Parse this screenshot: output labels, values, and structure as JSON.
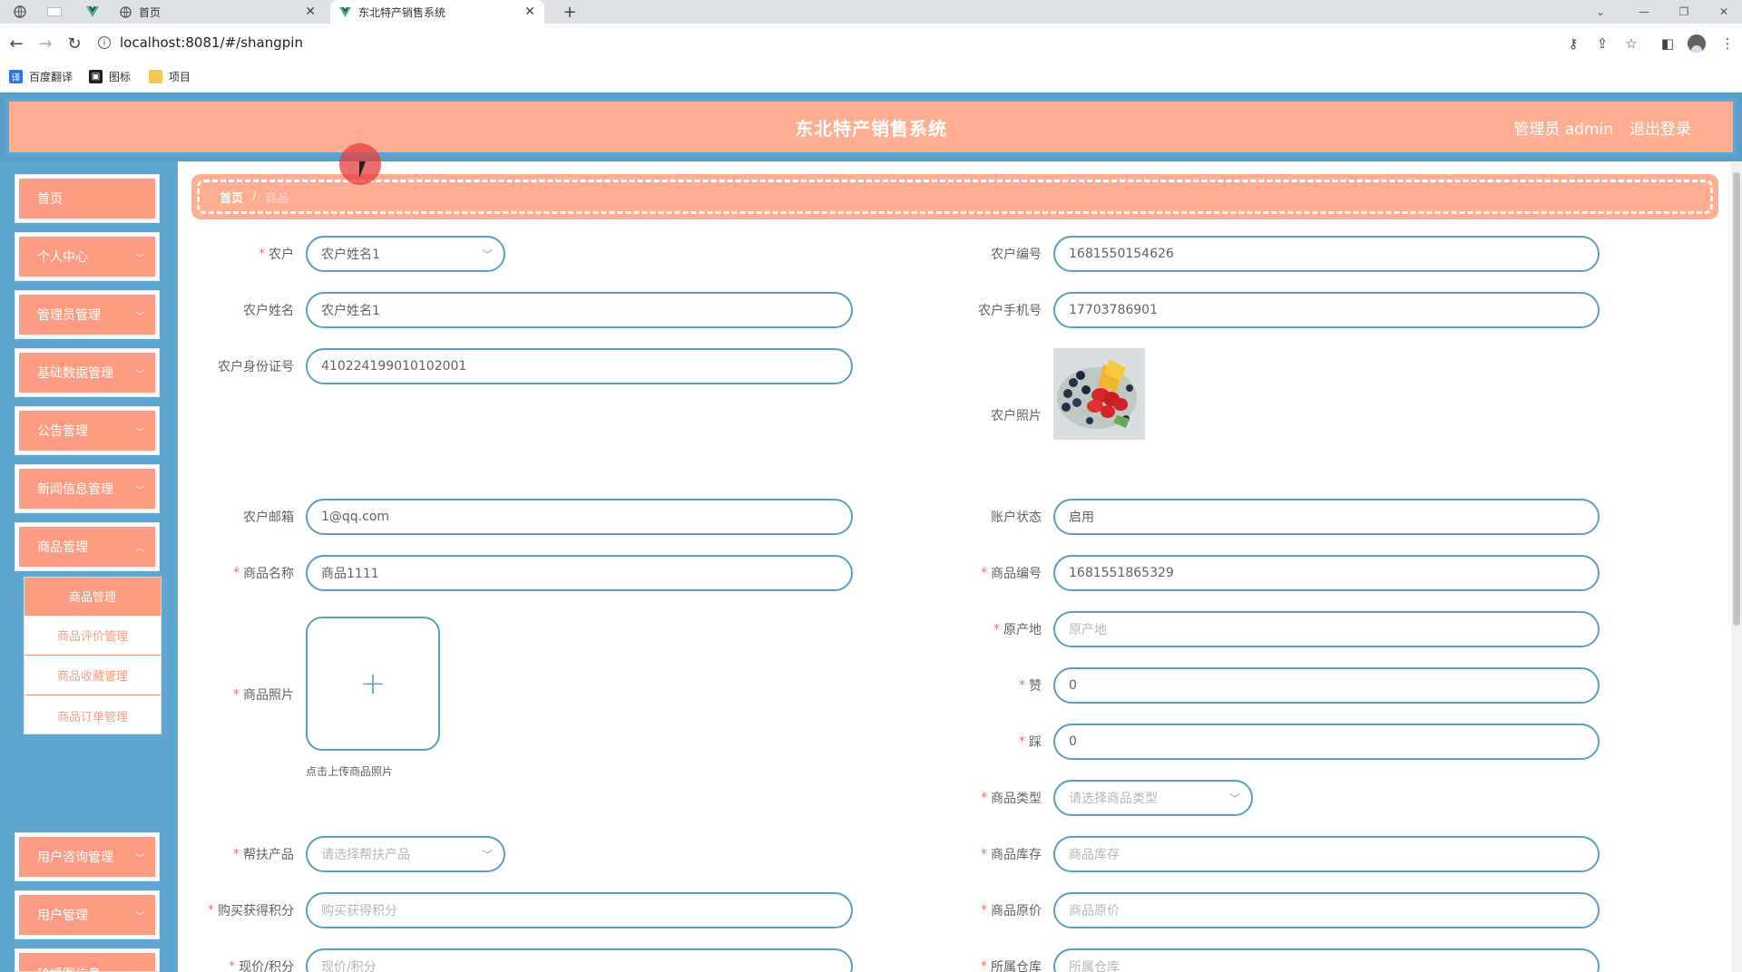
{
  "browser": {
    "tabs": [
      {
        "title": "首页",
        "active": false
      },
      {
        "title": "东北特产销售系统",
        "active": true
      }
    ],
    "url": "localhost:8081/#/shangpin",
    "bookmarks": [
      {
        "label": "百度翻译",
        "color": "#2f74e5"
      },
      {
        "label": "图标",
        "color": "#222222"
      },
      {
        "label": "项目",
        "color": "#f2c94c"
      }
    ]
  },
  "header": {
    "title": "东北特产销售系统",
    "user": "管理员 admin",
    "logout": "退出登录"
  },
  "sidebar": {
    "items": [
      {
        "label": "首页",
        "has_arrow": false
      },
      {
        "label": "个人中心",
        "has_arrow": true
      },
      {
        "label": "管理员管理",
        "has_arrow": true
      },
      {
        "label": "基础数据管理",
        "has_arrow": true
      },
      {
        "label": "公告管理",
        "has_arrow": true
      },
      {
        "label": "新闻信息管理",
        "has_arrow": true
      },
      {
        "label": "商品管理",
        "has_arrow": true
      },
      {
        "label": "用户咨询管理",
        "has_arrow": true
      },
      {
        "label": "用户管理",
        "has_arrow": true
      },
      {
        "label": "轮播图信息",
        "has_arrow": true
      }
    ],
    "submenu": [
      "商品管理",
      "商品评价管理",
      "商品收藏管理",
      "商品订单管理"
    ]
  },
  "breadcrumb": {
    "home": "首页",
    "sep": "/",
    "current": "商品"
  },
  "form": {
    "nonghu": {
      "label": "农户",
      "value": "农户姓名1",
      "required": true
    },
    "nonghu_bianhao": {
      "label": "农户编号",
      "value": "1681550154626"
    },
    "nonghu_name": {
      "label": "农户姓名",
      "value": "农户姓名1"
    },
    "nonghu_phone": {
      "label": "农户手机号",
      "value": "17703786901"
    },
    "nonghu_idcard": {
      "label": "农户身份证号",
      "value": "410224199010102001"
    },
    "nonghu_photo": {
      "label": "农户照片"
    },
    "nonghu_email": {
      "label": "农户邮箱",
      "value": "1@qq.com"
    },
    "account_status": {
      "label": "账户状态",
      "value": "启用"
    },
    "product_name": {
      "label": "商品名称",
      "value": "商品1111",
      "required": true
    },
    "product_code": {
      "label": "商品编号",
      "value": "1681551865329",
      "required": true
    },
    "product_photo": {
      "label": "商品照片",
      "tip": "点击上传商品照片",
      "required": true
    },
    "origin": {
      "label": "原产地",
      "placeholder": "原产地",
      "required": true
    },
    "zan": {
      "label": "赞",
      "value": "0",
      "required": true
    },
    "cai": {
      "label": "踩",
      "value": "0",
      "required": true
    },
    "product_type": {
      "label": "商品类型",
      "placeholder": "请选择商品类型",
      "required": true
    },
    "help_product": {
      "label": "帮扶产品",
      "placeholder": "请选择帮扶产品",
      "required": true
    },
    "stock": {
      "label": "商品库存",
      "placeholder": "商品库存",
      "required": true
    },
    "points": {
      "label": "购买获得积分",
      "placeholder": "购买获得积分",
      "required": true
    },
    "original_price": {
      "label": "商品原价",
      "placeholder": "商品原价",
      "required": true
    },
    "current_price": {
      "label": "现价/积分",
      "placeholder": "现价/积分",
      "required": true
    },
    "warehouse": {
      "label": "所属仓库",
      "placeholder": "所属仓库",
      "required": true
    }
  },
  "colors": {
    "header_bg": "#ffae91",
    "sidebar_bg": "#5fa6d0",
    "menu_item_bg": "#fd9c83",
    "field_border": "#5a9ec6",
    "required_mark": "#f56c6c"
  }
}
